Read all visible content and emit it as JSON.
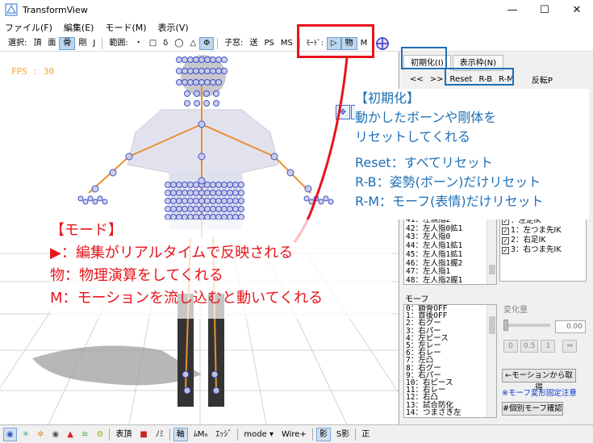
{
  "window": {
    "title": "TransformView",
    "minimize": "—",
    "maximize": "☐",
    "close": "✕"
  },
  "menu": [
    "ファイル(F)",
    "編集(E)",
    "モード(M)",
    "表示(V)"
  ],
  "toolbar": {
    "select_label": "選択:",
    "select_items": [
      "頂",
      "面",
      "骨",
      "剛",
      "J"
    ],
    "range_label": "範囲:",
    "range_items": [
      "・",
      "□",
      "δ",
      "◯",
      "△",
      "Φ"
    ],
    "child_label": "子窓:",
    "child_items": [
      "送",
      "PS",
      "MS"
    ],
    "mode_label": "ﾓｰﾄﾞ:",
    "mode_items": [
      "▷",
      "物",
      "M"
    ]
  },
  "viewport": {
    "fps": "FPS : 30"
  },
  "panel": {
    "tabs": [
      "初期化(I)",
      "表示枠(N)"
    ],
    "sub": [
      "<<",
      ">>",
      "Reset",
      "R-B",
      "R-M",
      "反転P"
    ],
    "bone_list": [
      "41：左親指2",
      "42：左人指0拡1",
      "43：左人指0",
      "44：左人指1拡1",
      "45：左人指1拡1",
      "46：左人指1握2",
      "47：左人指1",
      "48：左人指2握1"
    ],
    "check_list": [
      {
        "label": "：左足IK",
        "checked": true
      },
      {
        "label": "1：左つま先IK",
        "checked": true
      },
      {
        "label": "2：右足IK",
        "checked": true
      },
      {
        "label": "3：右つま先IK",
        "checked": true
      }
    ],
    "morph_label": "モーフ",
    "morph_list": [
      "0：鎖骨OFF",
      "1：首後OFF",
      "2：右グー",
      "3：右パー",
      "4：左ピース",
      "5：左レー",
      "6：右レー",
      "7：左凸",
      "8：右グー",
      "9：右パー",
      "10：右ピース",
      "11：右レー",
      "12：右凸",
      "13：試合防化",
      "14：つまさき左"
    ],
    "henka_label": "変化量",
    "value": "0.00",
    "preset_btns": [
      "0",
      "0.5",
      "1",
      "⇔"
    ],
    "motion_btn": "←モーションから取得",
    "note": "※モーフ変形固定注意",
    "confirm_btn": "#個別モーフ確認"
  },
  "statusbar": {
    "items": [
      "表頂",
      "ﾉﾐ",
      "軸",
      "ﾑM₀",
      "ｴｯｼﾞ",
      "mode ▾",
      "Wire+",
      "影",
      "S影",
      "正"
    ]
  },
  "annotation_mode": {
    "lines": [
      "【モード】",
      "▶：編集がリアルタイムで反映される",
      "物：物理演算をしてくれる",
      "M：モーションを流し込むと動いてくれる"
    ]
  },
  "annotation_init": {
    "lines": [
      "【初期化】",
      "動かしたボーンや剛体を",
      "リセットしてくれる",
      "",
      "Reset：すべてリセット",
      "R-B：姿勢(ボーン)だけリセット",
      "R-M：モーフ(表情)だけリセット"
    ]
  },
  "colors": {
    "annotation_red": "#e8141b",
    "annotation_blue": "#1e6fb5",
    "fps": "#f2a53a",
    "bones": "#3040c8"
  }
}
